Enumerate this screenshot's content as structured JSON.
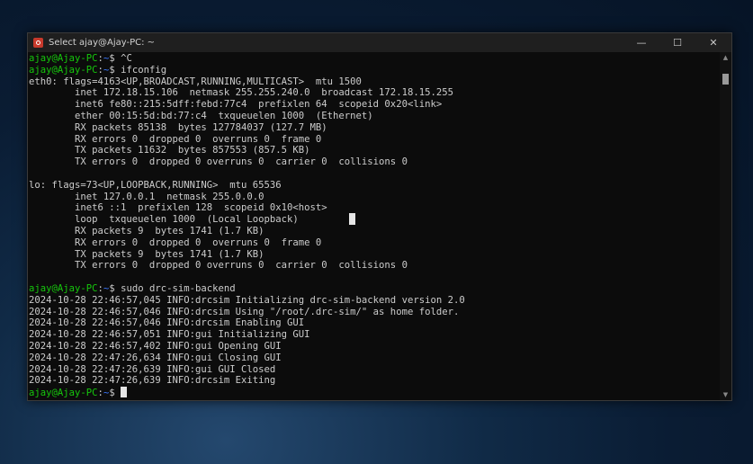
{
  "window": {
    "title": "Select ajay@Ajay-PC: ~"
  },
  "controls": {
    "minimize": "—",
    "maximize": "☐",
    "close": "✕"
  },
  "scrollbar": {
    "up": "▲",
    "down": "▼"
  },
  "prompt": {
    "user_host": "ajay@Ajay-PC",
    "sep": ":",
    "path": "~",
    "suffix": "$ "
  },
  "terminal_lines": [
    {
      "prompt": true,
      "cmd": "^C"
    },
    {
      "prompt": true,
      "cmd": "ifconfig"
    },
    {
      "text": "eth0: flags=4163<UP,BROADCAST,RUNNING,MULTICAST>  mtu 1500"
    },
    {
      "text": "        inet 172.18.15.106  netmask 255.255.240.0  broadcast 172.18.15.255"
    },
    {
      "text": "        inet6 fe80::215:5dff:febd:77c4  prefixlen 64  scopeid 0x20<link>"
    },
    {
      "text": "        ether 00:15:5d:bd:77:c4  txqueuelen 1000  (Ethernet)"
    },
    {
      "text": "        RX packets 85138  bytes 127784037 (127.7 MB)"
    },
    {
      "text": "        RX errors 0  dropped 0  overruns 0  frame 0"
    },
    {
      "text": "        TX packets 11632  bytes 857553 (857.5 KB)"
    },
    {
      "text": "        TX errors 0  dropped 0 overruns 0  carrier 0  collisions 0"
    },
    {
      "text": ""
    },
    {
      "text": "lo: flags=73<UP,LOOPBACK,RUNNING>  mtu 65536"
    },
    {
      "text": "        inet 127.0.0.1  netmask 255.0.0.0"
    },
    {
      "text": "        inet6 ::1  prefixlen 128  scopeid 0x10<host>"
    },
    {
      "text": "        loop  txqueuelen 1000  (Local Loopback)"
    },
    {
      "text": "        RX packets 9  bytes 1741 (1.7 KB)"
    },
    {
      "text": "        RX errors 0  dropped 0  overruns 0  frame 0"
    },
    {
      "text": "        TX packets 9  bytes 1741 (1.7 KB)"
    },
    {
      "text": "        TX errors 0  dropped 0 overruns 0  carrier 0  collisions 0"
    },
    {
      "text": ""
    },
    {
      "prompt": true,
      "cmd": "sudo drc-sim-backend"
    },
    {
      "text": "2024-10-28 22:46:57,045 INFO:drcsim Initializing drc-sim-backend version 2.0"
    },
    {
      "text": "2024-10-28 22:46:57,046 INFO:drcsim Using \"/root/.drc-sim/\" as home folder."
    },
    {
      "text": "2024-10-28 22:46:57,046 INFO:drcsim Enabling GUI"
    },
    {
      "text": "2024-10-28 22:46:57,051 INFO:gui Initializing GUI"
    },
    {
      "text": "2024-10-28 22:46:57,402 INFO:gui Opening GUI"
    },
    {
      "text": "2024-10-28 22:47:26,634 INFO:gui Closing GUI"
    },
    {
      "text": "2024-10-28 22:47:26,639 INFO:gui GUI Closed"
    },
    {
      "text": "2024-10-28 22:47:26,639 INFO:drcsim Exiting"
    },
    {
      "prompt": true,
      "cmd": "",
      "cursor": true
    }
  ],
  "colors": {
    "prompt_user": "#16c60c",
    "prompt_path": "#3b78ff",
    "terminal_bg": "#0c0c0c",
    "text": "#cccccc"
  }
}
